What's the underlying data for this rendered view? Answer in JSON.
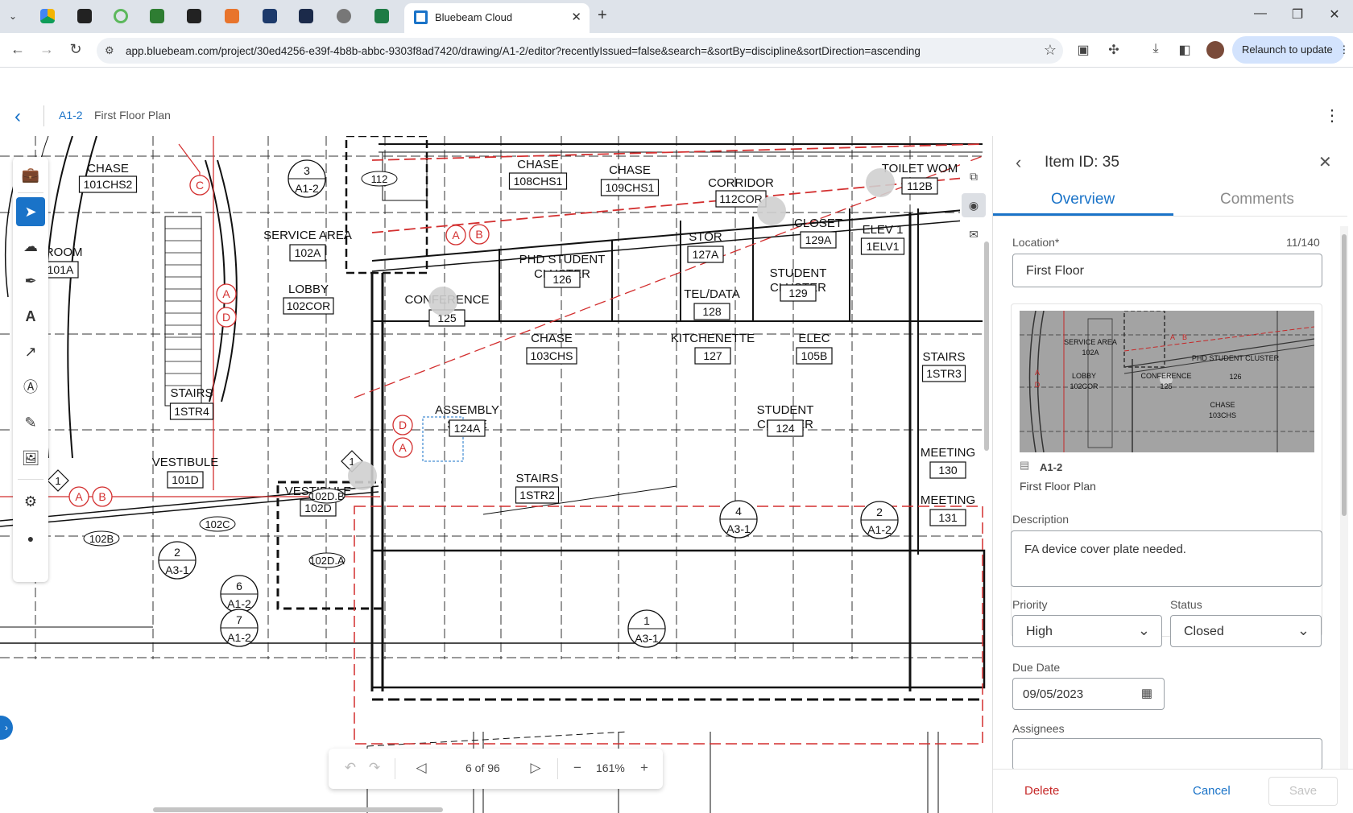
{
  "browser": {
    "active_tab_title": "Bluebeam Cloud",
    "url": "app.bluebeam.com/project/30ed4256-e39f-4b8b-abbc-9303f8ad7420/drawing/A1-2/editor?recentlyIssued=false&search=&sortBy=discipline&sortDirection=ascending",
    "relaunch_label": "Relaunch to update"
  },
  "header": {
    "sheet_id": "A1-2",
    "sheet_title": "First Floor Plan"
  },
  "drawing": {
    "rooms": [
      {
        "name": "CHASE",
        "num": "101CHS2"
      },
      {
        "name": "CHASE",
        "num": "108CHS1"
      },
      {
        "name": "CHASE",
        "num": "109CHS1"
      },
      {
        "name": "CORRIDOR",
        "num": "112COR"
      },
      {
        "name": "TOILET WOM",
        "num": "112B"
      },
      {
        "name": "SERVICE AREA",
        "num": "102A"
      },
      {
        "name": "LOBBY",
        "num": "102COR"
      },
      {
        "name": "/ ROOM",
        "num": "101A"
      },
      {
        "name": "STOR",
        "num": "127A"
      },
      {
        "name": "CLOSET",
        "num": "129A"
      },
      {
        "name": "ELEV 1",
        "num": "1ELV1"
      },
      {
        "name": "PHD STUDENT CLUSTER",
        "num": "126"
      },
      {
        "name": "CONFERENCE",
        "num": "125"
      },
      {
        "name": "TEL/DATA",
        "num": "128"
      },
      {
        "name": "STUDENT CLUSTER",
        "num": "129"
      },
      {
        "name": "CHASE",
        "num": "103CHS"
      },
      {
        "name": "KITCHENETTE",
        "num": "127"
      },
      {
        "name": "ELEC",
        "num": "105B"
      },
      {
        "name": "STAIRS",
        "num": "1STR3"
      },
      {
        "name": "STAIRS",
        "num": "1STR4"
      },
      {
        "name": "ASSEMBLY SPACE",
        "num": "124A"
      },
      {
        "name": "STUDENT CLUSTER",
        "num": "124"
      },
      {
        "name": "VESTIBULE",
        "num": "101D"
      },
      {
        "name": "STAIRS",
        "num": "1STR2"
      },
      {
        "name": "VESTIBULE",
        "num": "102D"
      },
      {
        "name": "MEETING",
        "num": "130"
      },
      {
        "name": "MEETING",
        "num": "131"
      }
    ],
    "tags": [
      "102D.B",
      "102D.A",
      "102C",
      "102B",
      "112"
    ],
    "grid_bubbles": [
      "C",
      "A",
      "B",
      "A",
      "D",
      "D",
      "A",
      "A",
      "B"
    ],
    "callouts": [
      {
        "top": "3",
        "bottom": "A1-2"
      },
      {
        "top": "2",
        "bottom": "A3-1"
      },
      {
        "top": "6",
        "bottom": "A1-2"
      },
      {
        "top": "7",
        "bottom": "A1-2"
      },
      {
        "top": "4",
        "bottom": "A3-1"
      },
      {
        "top": "2",
        "bottom": "A1-2"
      },
      {
        "top": "1",
        "bottom": "A3-1"
      }
    ],
    "diamond_tags": [
      "1",
      "1"
    ]
  },
  "left_toolbar": {
    "tools": [
      "briefcase-icon",
      "pointer-icon",
      "cloud-icon",
      "pen-icon",
      "text-icon",
      "arrow-icon",
      "textbox-icon",
      "highlighter-icon",
      "image-icon",
      "gear-hash-icon",
      "dot-icon"
    ]
  },
  "pager": {
    "page_label": "6 of 96",
    "zoom_label": "161%"
  },
  "panel": {
    "title": "Item ID: 35",
    "tab_overview": "Overview",
    "tab_comments": "Comments",
    "location_label": "Location*",
    "location_counter": "11/140",
    "location_value": "First Floor",
    "thumb_sheet_id": "A1-2",
    "thumb_sheet_name": "First Floor Plan",
    "thumb_labels": [
      "SERVICE AREA",
      "102A",
      "LOBBY",
      "102COR",
      "PHD STUDENT CLUSTER",
      "126",
      "CONFERENCE",
      "125",
      "CHASE",
      "103CHS",
      "A",
      "B",
      "A",
      "D"
    ],
    "description_label": "Description",
    "description_value": "FA device cover plate needed.",
    "priority_label": "Priority",
    "priority_value": "High",
    "status_label": "Status",
    "status_value": "Closed",
    "due_label": "Due Date",
    "due_value": "09/05/2023",
    "assignees_label": "Assignees",
    "delete_label": "Delete",
    "cancel_label": "Cancel",
    "save_label": "Save"
  },
  "colors": {
    "accent": "#1a73c8",
    "markup_red": "#d32f2f",
    "delete_red": "#c62828"
  }
}
